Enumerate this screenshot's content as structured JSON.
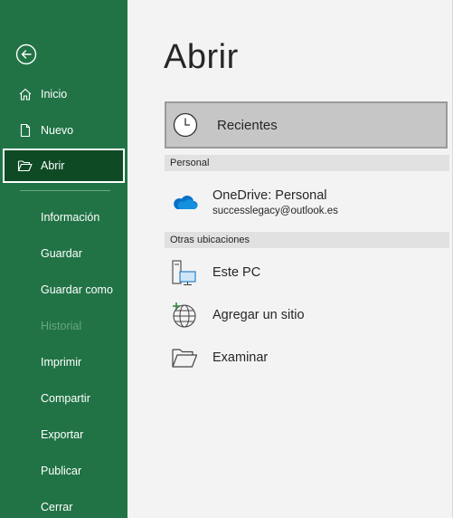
{
  "sidebar": {
    "back": {
      "icon": "back-arrow-icon"
    },
    "items": [
      {
        "label": "Inicio",
        "icon": "home-icon"
      },
      {
        "label": "Nuevo",
        "icon": "new-document-icon"
      },
      {
        "label": "Abrir",
        "icon": "open-folder-icon",
        "selected": true
      }
    ],
    "sub_items": [
      {
        "label": "Información"
      },
      {
        "label": "Guardar"
      },
      {
        "label": "Guardar como"
      },
      {
        "label": "Historial",
        "disabled": true
      },
      {
        "label": "Imprimir"
      },
      {
        "label": "Compartir"
      },
      {
        "label": "Exportar"
      },
      {
        "label": "Publicar"
      },
      {
        "label": "Cerrar"
      }
    ]
  },
  "main": {
    "title": "Abrir",
    "recent": {
      "label": "Recientes",
      "icon": "clock-icon"
    },
    "sections": [
      {
        "header": "Personal",
        "places": [
          {
            "title": "OneDrive: Personal",
            "subtitle": "successlegacy@outlook.es",
            "icon": "onedrive-cloud-icon"
          }
        ]
      },
      {
        "header": "Otras ubicaciones",
        "places": [
          {
            "title": "Este PC",
            "icon": "this-pc-icon"
          },
          {
            "title": "Agregar un sitio",
            "icon": "add-place-globe-icon"
          },
          {
            "title": "Examinar",
            "icon": "browse-folder-icon"
          }
        ]
      }
    ]
  },
  "colors": {
    "sidebar_bg": "#217346",
    "selected_bg": "#0e4a24",
    "main_bg": "#f3f3f3",
    "recent_bg": "#c6c6c6",
    "section_header_bg": "#e1e1e1",
    "onedrive_blue": "#0a70c9"
  }
}
